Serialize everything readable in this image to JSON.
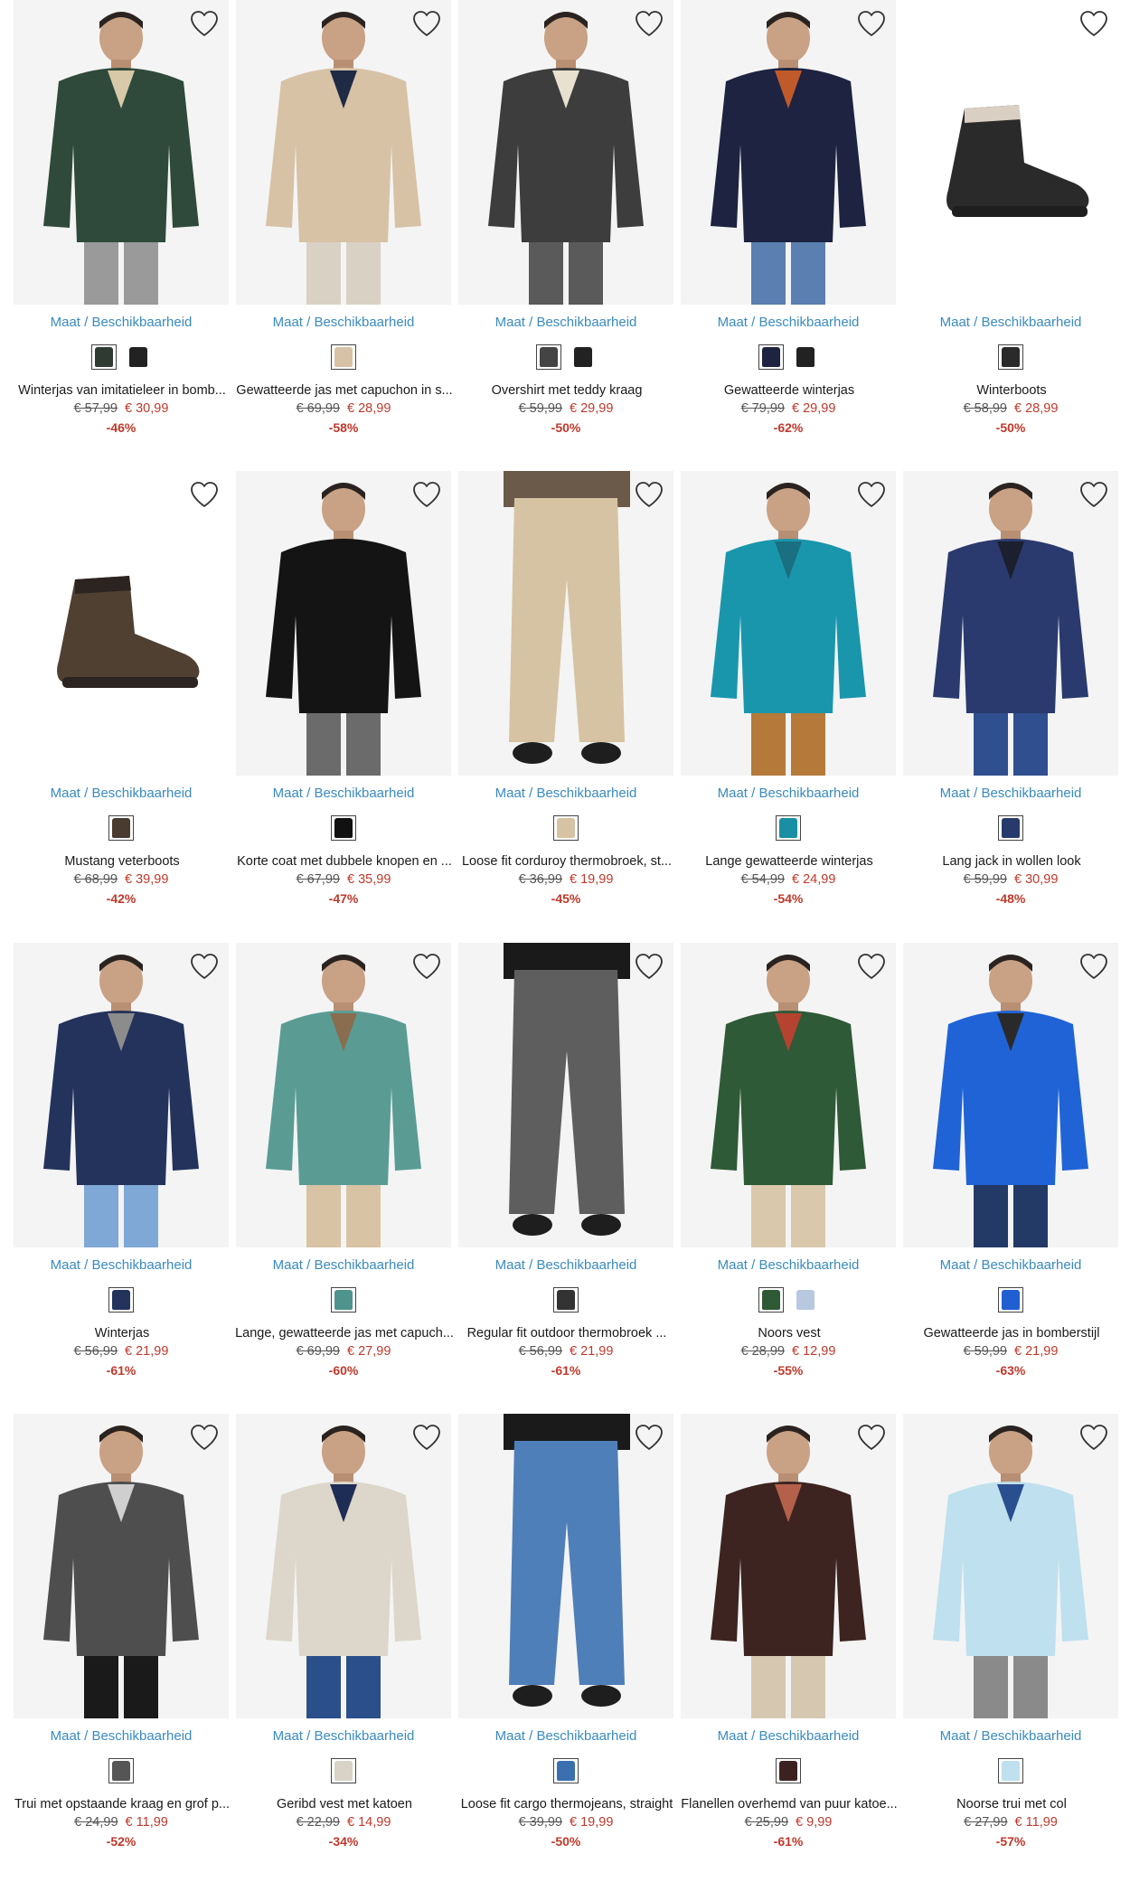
{
  "colors": {
    "link": "#3a8bc2",
    "sale": "#c0392b",
    "strike": "#555555"
  },
  "products": [
    {
      "size_link": "Maat / Beschikbaarheid",
      "name": "Winterjas van imitatieleer in bomb...",
      "old_price": "€ 57,99",
      "new_price": "€ 30,99",
      "discount": "-46%",
      "swatches": [
        "#2f3a33",
        "#222222"
      ],
      "kind": "jacket",
      "main": "#2f4a3a",
      "accent": "#d8c9a8",
      "legs": "#9a9a9a",
      "bg": "#f4f4f4"
    },
    {
      "size_link": "Maat / Beschikbaarheid",
      "name": "Gewatteerde jas met capuchon in s...",
      "old_price": "€ 69,99",
      "new_price": "€ 28,99",
      "discount": "-58%",
      "swatches": [
        "#d7c2a6"
      ],
      "kind": "jacket",
      "main": "#d7c2a6",
      "accent": "#1f2a44",
      "legs": "#d9d2c4",
      "bg": "#f4f4f4"
    },
    {
      "size_link": "Maat / Beschikbaarheid",
      "name": "Overshirt met teddy kraag",
      "old_price": "€ 59,99",
      "new_price": "€ 29,99",
      "discount": "-50%",
      "swatches": [
        "#444444",
        "#222222"
      ],
      "kind": "jacket",
      "main": "#3d3d3d",
      "accent": "#e9e1d0",
      "legs": "#5a5a5a",
      "bg": "#f4f4f4"
    },
    {
      "size_link": "Maat / Beschikbaarheid",
      "name": "Gewatteerde winterjas",
      "old_price": "€ 79,99",
      "new_price": "€ 29,99",
      "discount": "-62%",
      "swatches": [
        "#1d2340",
        "#222222"
      ],
      "kind": "jacket",
      "main": "#1d2340",
      "accent": "#c05a2a",
      "legs": "#5b7fb0",
      "bg": "#f4f4f4"
    },
    {
      "size_link": "Maat / Beschikbaarheid",
      "name": "Winterboots",
      "old_price": "€ 58,99",
      "new_price": "€ 28,99",
      "discount": "-50%",
      "swatches": [
        "#2a2a2a"
      ],
      "kind": "boot",
      "main": "#2a2a2a",
      "accent": "#d9cfc2",
      "legs": "#2a2a2a",
      "bg": "#ffffff"
    },
    {
      "size_link": "Maat / Beschikbaarheid",
      "name": "Mustang veterboots",
      "old_price": "€ 68,99",
      "new_price": "€ 39,99",
      "discount": "-42%",
      "swatches": [
        "#4a3b30"
      ],
      "kind": "boot",
      "main": "#4f4032",
      "accent": "#2b2420",
      "legs": "#4f4032",
      "bg": "#ffffff"
    },
    {
      "size_link": "Maat / Beschikbaarheid",
      "name": "Korte coat met dubbele knopen en ...",
      "old_price": "€ 67,99",
      "new_price": "€ 35,99",
      "discount": "-47%",
      "swatches": [
        "#111111"
      ],
      "kind": "jacket",
      "main": "#141414",
      "accent": "#141414",
      "legs": "#6b6b6b",
      "bg": "#f4f4f4"
    },
    {
      "size_link": "Maat / Beschikbaarheid",
      "name": "Loose fit corduroy thermobroek, st...",
      "old_price": "€ 36,99",
      "new_price": "€ 19,99",
      "discount": "-45%",
      "swatches": [
        "#d6c3a3"
      ],
      "kind": "pants",
      "main": "#d6c3a3",
      "accent": "#6b5a4a",
      "legs": "#d6c3a3",
      "bg": "#f4f4f4"
    },
    {
      "size_link": "Maat / Beschikbaarheid",
      "name": "Lange gewatteerde winterjas",
      "old_price": "€ 54,99",
      "new_price": "€ 24,99",
      "discount": "-54%",
      "swatches": [
        "#1a8fa3"
      ],
      "kind": "jacket",
      "main": "#1a96ac",
      "accent": "#1a6f80",
      "legs": "#b57a3a",
      "bg": "#f4f4f4"
    },
    {
      "size_link": "Maat / Beschikbaarheid",
      "name": "Lang jack in wollen look",
      "old_price": "€ 59,99",
      "new_price": "€ 30,99",
      "discount": "-48%",
      "swatches": [
        "#283a6b"
      ],
      "kind": "jacket",
      "main": "#2a3a6e",
      "accent": "#1b1f2e",
      "legs": "#2f4f8f",
      "bg": "#f4f4f4"
    },
    {
      "size_link": "Maat / Beschikbaarheid",
      "name": "Winterjas",
      "old_price": "€ 56,99",
      "new_price": "€ 21,99",
      "discount": "-61%",
      "swatches": [
        "#24335c"
      ],
      "kind": "jacket",
      "main": "#24335c",
      "accent": "#8c8c8c",
      "legs": "#7fa8d6",
      "bg": "#f4f4f4"
    },
    {
      "size_link": "Maat / Beschikbaarheid",
      "name": "Lange, gewatteerde jas met capuch...",
      "old_price": "€ 69,99",
      "new_price": "€ 27,99",
      "discount": "-60%",
      "swatches": [
        "#4f948c"
      ],
      "kind": "jacket",
      "main": "#5a9c94",
      "accent": "#8a6d4f",
      "legs": "#d8c3a5",
      "bg": "#f4f4f4"
    },
    {
      "size_link": "Maat / Beschikbaarheid",
      "name": "Regular fit outdoor thermobroek ...",
      "old_price": "€ 56,99",
      "new_price": "€ 21,99",
      "discount": "-61%",
      "swatches": [
        "#333333"
      ],
      "kind": "pants",
      "main": "#5e5e5e",
      "accent": "#1a1a1a",
      "legs": "#5e5e5e",
      "bg": "#f4f4f4"
    },
    {
      "size_link": "Maat / Beschikbaarheid",
      "name": "Noors vest",
      "old_price": "€ 28,99",
      "new_price": "€ 12,99",
      "discount": "-55%",
      "swatches": [
        "#2e5a36",
        "#b8c8e0"
      ],
      "kind": "jacket",
      "main": "#2f5a37",
      "accent": "#b5432f",
      "legs": "#d9c8ac",
      "bg": "#f4f4f4"
    },
    {
      "size_link": "Maat / Beschikbaarheid",
      "name": "Gewatteerde jas in bomberstijl",
      "old_price": "€ 59,99",
      "new_price": "€ 21,99",
      "discount": "-63%",
      "swatches": [
        "#1f5fd1"
      ],
      "kind": "jacket",
      "main": "#1f63d6",
      "accent": "#2a2a2a",
      "legs": "#233a66",
      "bg": "#f4f4f4"
    },
    {
      "size_link": "Maat / Beschikbaarheid",
      "name": "Trui met opstaande kraag en grof p...",
      "old_price": "€ 24,99",
      "new_price": "€ 11,99",
      "discount": "-52%",
      "swatches": [
        "#555555"
      ],
      "kind": "jacket",
      "main": "#4e4e4e",
      "accent": "#cfcfcf",
      "legs": "#1a1a1a",
      "bg": "#f4f4f4"
    },
    {
      "size_link": "Maat / Beschikbaarheid",
      "name": "Geribd vest met katoen",
      "old_price": "€ 22,99",
      "new_price": "€ 14,99",
      "discount": "-34%",
      "swatches": [
        "#d8d3c6"
      ],
      "kind": "jacket",
      "main": "#dcd7ca",
      "accent": "#1e2d55",
      "legs": "#2b4f8a",
      "bg": "#f4f4f4"
    },
    {
      "size_link": "Maat / Beschikbaarheid",
      "name": "Loose fit cargo thermojeans, straight",
      "old_price": "€ 39,99",
      "new_price": "€ 19,99",
      "discount": "-50%",
      "swatches": [
        "#3a6fb0"
      ],
      "kind": "pants",
      "main": "#4f7fb8",
      "accent": "#1a1a1a",
      "legs": "#4f7fb8",
      "bg": "#f4f4f4"
    },
    {
      "size_link": "Maat / Beschikbaarheid",
      "name": "Flanellen overhemd van puur katoe...",
      "old_price": "€ 25,99",
      "new_price": "€ 9,99",
      "discount": "-61%",
      "swatches": [
        "#3b2220"
      ],
      "kind": "jacket",
      "main": "#3d2421",
      "accent": "#b4604a",
      "legs": "#d6c8b0",
      "bg": "#f4f4f4"
    },
    {
      "size_link": "Maat / Beschikbaarheid",
      "name": "Noorse trui met col",
      "old_price": "€ 27,99",
      "new_price": "€ 11,99",
      "discount": "-57%",
      "swatches": [
        "#bfe0ee"
      ],
      "kind": "jacket",
      "main": "#bfe0ee",
      "accent": "#2a4f8f",
      "legs": "#8a8a8a",
      "bg": "#f4f4f4"
    }
  ]
}
